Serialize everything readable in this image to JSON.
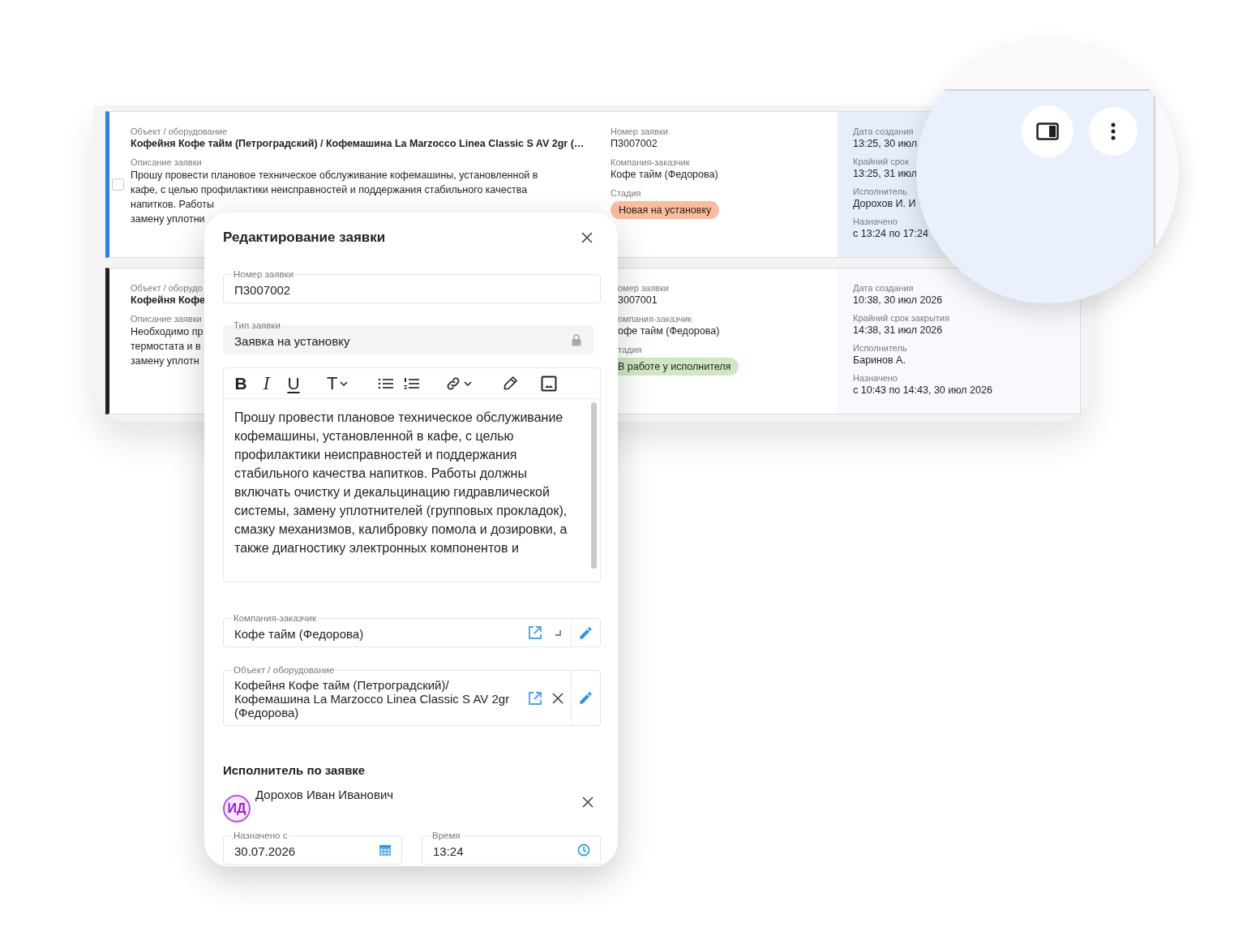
{
  "requests": [
    {
      "color": "#2f80ed",
      "selected": true,
      "checkbox": {
        "checked": false
      },
      "main": [
        {
          "kind": "title",
          "label": "Объект / оборудование",
          "value": "Кофейня Кофе тайм (Петроградский) / Кофемашина La Marzocco Linea Classic S AV 2gr (…"
        },
        {
          "kind": "lines",
          "label": "Описание заявки",
          "lines": [
            "Прошу провести плановое техническое обслуживание кофемашины, установленной в",
            "кафе, с целью профилактики неисправностей и поддержания стабильного качества",
            "напитков. Работы",
            "замену уплотни"
          ]
        }
      ],
      "details": [
        {
          "kind": "text",
          "label": "Номер заявки",
          "value": "П3007002"
        },
        {
          "kind": "text",
          "label": "Компания-заказчик",
          "value": "Кофе тайм (Федорова)"
        },
        {
          "kind": "badge",
          "label": "Стадия",
          "value": "Новая на установку",
          "color": "#fbbc9e"
        }
      ],
      "dates": [
        {
          "label": "Дата создания",
          "value": "13:25, 30 июл"
        },
        {
          "label": "Крайний срок",
          "value": "13:25, 31 июл"
        },
        {
          "label": "Исполнитель",
          "value": "Дорохов И. И"
        },
        {
          "label": "Назначено",
          "value": "с 13:24 по 17:24"
        }
      ]
    },
    {
      "color": "#1f1f1f",
      "selected": false,
      "main": [
        {
          "kind": "title",
          "label": "Объект / оборудо",
          "value": "Кофейня Кофе"
        },
        {
          "kind": "lines",
          "label": "Описание заявки",
          "lines": [
            "Необходимо пр",
            "термостата и в",
            "замену уплотн"
          ]
        }
      ],
      "details": [
        {
          "kind": "text",
          "label": "омер заявки",
          "value": "3007001"
        },
        {
          "kind": "text",
          "label": "омпания-заказчик",
          "value": "офе тайм (Федорова)"
        },
        {
          "kind": "badge",
          "label": "тадия",
          "value": "В работе у исполнителя",
          "color": "#cfe8c4"
        }
      ],
      "dates": [
        {
          "label": "Дата создания",
          "value": "10:38, 30 июл 2026"
        },
        {
          "label": "Крайний срок закрытия",
          "value": "14:38, 31 июл 2026"
        },
        {
          "label": "Исполнитель",
          "value": "Баринов А."
        },
        {
          "label": "Назначено",
          "value": "с 10:43 по 14:43, 30 июл 2026"
        }
      ]
    }
  ],
  "editor": {
    "title": "Редактирование заявки",
    "fields": [
      {
        "kind": "text",
        "label": "Номер заявки",
        "value": "П3007002"
      },
      {
        "kind": "locked",
        "label": "Тип заявки",
        "value": "Заявка на установку"
      }
    ],
    "toolbar": [
      {
        "kind": "bold",
        "label": "B"
      },
      {
        "kind": "italic",
        "label": "I"
      },
      {
        "kind": "underline",
        "label": "U"
      },
      {
        "kind": "text-style",
        "label": "T"
      },
      {
        "kind": "bullet-list"
      },
      {
        "kind": "numbered-list"
      },
      {
        "kind": "link"
      },
      {
        "kind": "highlighter"
      },
      {
        "kind": "image"
      }
    ],
    "body": "Прошу провести плановое техническое обслуживание кофемашины, установленной в кафе, с целью профилактики неисправностей и поддержания стабильного качества напитков. Работы должны включать очистку и декальцинацию гидравлической системы, замену уплотнителей (групповых прокладок), смазку механизмов, калибровку помола и дозировки, а также диагностику электронных компонентов и",
    "links": [
      {
        "kind": "mark",
        "label": "Компания-заказчик",
        "value": "Кофе тайм (Федорова)"
      },
      {
        "kind": "clear",
        "label": "Объект / оборудование",
        "value": "Кофейня Кофе тайм (Петроградский)/ Кофемашина La Marzocco Linea Classic S AV 2gr (Федорова)"
      }
    ],
    "assignee_section": "Исполнитель по заявке",
    "assignee": {
      "initials": "ИД",
      "name": "Дорохов Иван Иванович"
    },
    "schedule": [
      {
        "kind": "date",
        "label": "Назначено с",
        "value": "30.07.2026"
      },
      {
        "kind": "time",
        "label": "Время",
        "value": "13:24"
      }
    ]
  }
}
